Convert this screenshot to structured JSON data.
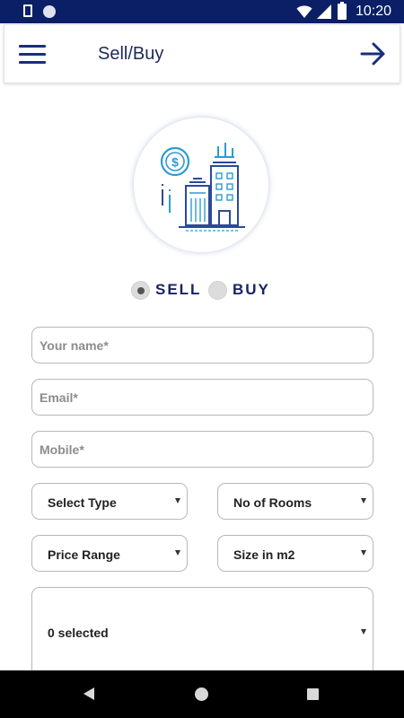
{
  "status_bar": {
    "time": "10:20",
    "icons": [
      "sd-card-icon",
      "notification-dot-icon",
      "wifi-icon",
      "cellular-icon",
      "battery-charging-icon"
    ],
    "background": "#0b1f66"
  },
  "app_bar": {
    "title": "Sell/Buy",
    "left_icon": "hamburger-menu-icon",
    "right_icon": "arrow-right-icon",
    "accent": "#1a2f7a"
  },
  "hero": {
    "icon": "real-estate-buildings-dollar-icon"
  },
  "mode": {
    "options": [
      {
        "label": "SELL",
        "selected": true
      },
      {
        "label": "BUY",
        "selected": false
      }
    ]
  },
  "form": {
    "name": {
      "placeholder": "Your name*",
      "value": ""
    },
    "email": {
      "placeholder": "Email*",
      "value": ""
    },
    "mobile": {
      "placeholder": "Mobile*",
      "value": ""
    },
    "type_select": {
      "value": "Select Type"
    },
    "rooms_select": {
      "value": "No of Rooms"
    },
    "price_select": {
      "value": "Price Range"
    },
    "size_select": {
      "value": "Size in m2"
    },
    "multi_select": {
      "value": "0 selected"
    }
  },
  "nav_bar": {
    "icons": [
      "back-icon",
      "home-icon",
      "recent-apps-icon"
    ]
  }
}
